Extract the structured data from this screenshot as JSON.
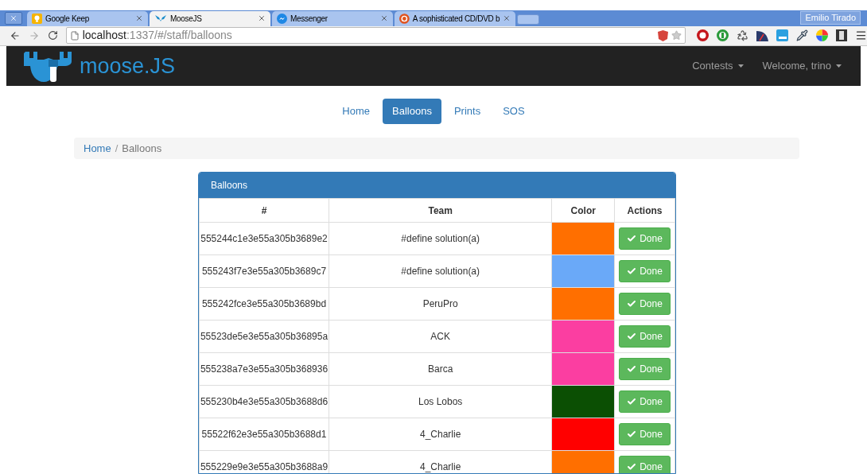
{
  "browser": {
    "tabs": [
      {
        "title": "Google Keep",
        "selected": false,
        "kind": "keep"
      },
      {
        "title": "MooseJS",
        "selected": true,
        "kind": "moose"
      },
      {
        "title": "Messenger",
        "selected": false,
        "kind": "messenger"
      },
      {
        "title": "A sophisticated CD/DVD b",
        "selected": false,
        "kind": "ubuntu"
      }
    ],
    "profile": "Emilio Tirado",
    "url_host": "localhost",
    "url_path": ":1337/#/staff/balloons"
  },
  "navbar": {
    "brand": "moose.JS",
    "menus": [
      "Contests",
      "Welcome, trino"
    ]
  },
  "nav_pills": [
    {
      "label": "Home",
      "selected": false
    },
    {
      "label": "Balloons",
      "selected": true
    },
    {
      "label": "Prints",
      "selected": false
    },
    {
      "label": "SOS",
      "selected": false
    }
  ],
  "breadcrumb_separator": "/",
  "breadcrumb": [
    {
      "label": "Home",
      "selected": false
    },
    {
      "label": "Balloons",
      "selected": true
    }
  ],
  "panel": {
    "title": "Balloons",
    "columns": [
      "#",
      "Team",
      "Color",
      "Actions"
    ],
    "rows": [
      {
        "id": "555244c1e3e55a305b3689e2",
        "team": "#define solution(a)",
        "color": "#ff6f00",
        "action": "Done"
      },
      {
        "id": "555243f7e3e55a305b3689c7",
        "team": "#define solution(a)",
        "color": "#6aa9f8",
        "action": "Done"
      },
      {
        "id": "555242fce3e55a305b3689bd",
        "team": "PeruPro",
        "color": "#ff6f00",
        "action": "Done"
      },
      {
        "id": "55523de5e3e55a305b36895a",
        "team": "ACK",
        "color": "#fb3ea1",
        "action": "Done"
      },
      {
        "id": "555238a7e3e55a305b368936",
        "team": "Barca",
        "color": "#fb3ea1",
        "action": "Done"
      },
      {
        "id": "555230b4e3e55a305b3688d6",
        "team": "Los Lobos",
        "color": "#0b4f03",
        "action": "Done"
      },
      {
        "id": "55522f62e3e55a305b3688d1",
        "team": "4_Charlie",
        "color": "#ff0000",
        "action": "Done"
      },
      {
        "id": "555229e9e3e55a305b3688a9",
        "team": "4_Charlie",
        "color": "#ff6f00",
        "action": "Done"
      }
    ]
  }
}
